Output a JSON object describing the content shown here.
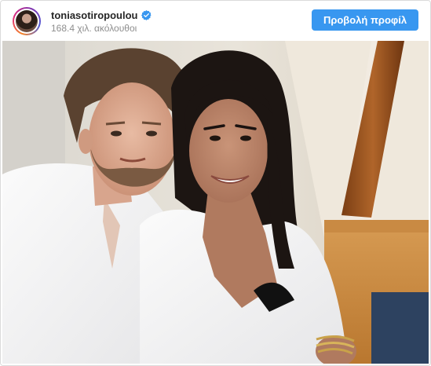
{
  "header": {
    "username": "toniasotiropoulou",
    "followers": "168.4 χιλ. ακόλουθοι",
    "view_profile_label": "Προβολή προφίλ",
    "verified_icon": "verified-badge-icon",
    "button_color": "#3897f0"
  },
  "post": {
    "image_kind": "selfie-photo"
  }
}
